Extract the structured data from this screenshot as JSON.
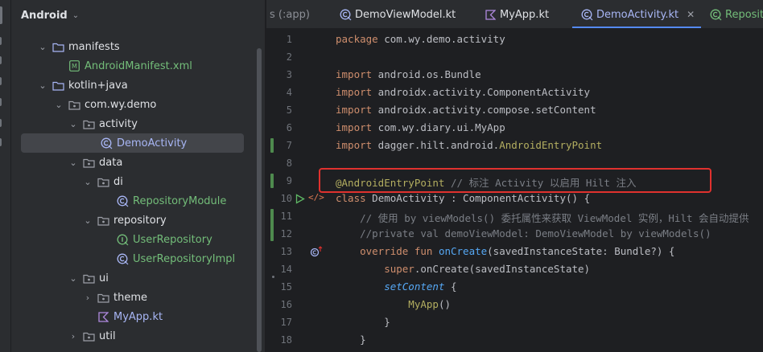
{
  "project_panel": {
    "title": "Android",
    "tree": [
      {
        "label": "manifests",
        "type": "folder"
      },
      {
        "label": "AndroidManifest.xml",
        "type": "manifest-file"
      },
      {
        "label": "kotlin+java",
        "type": "folder"
      },
      {
        "label": "com.wy.demo",
        "type": "package"
      },
      {
        "label": "activity",
        "type": "package"
      },
      {
        "label": "DemoActivity",
        "type": "class",
        "selected": true
      },
      {
        "label": "data",
        "type": "package"
      },
      {
        "label": "di",
        "type": "package"
      },
      {
        "label": "RepositoryModule",
        "type": "class"
      },
      {
        "label": "repository",
        "type": "package"
      },
      {
        "label": "UserRepository",
        "type": "interface"
      },
      {
        "label": "UserRepositoryImpl",
        "type": "class"
      },
      {
        "label": "ui",
        "type": "package"
      },
      {
        "label": "theme",
        "type": "package"
      },
      {
        "label": "MyApp.kt",
        "type": "kotlin-file"
      },
      {
        "label": "util",
        "type": "package"
      }
    ]
  },
  "tabs": [
    {
      "label": "s (:app)",
      "active": false
    },
    {
      "label": "DemoViewModel.kt",
      "active": false
    },
    {
      "label": "MyApp.kt",
      "active": false
    },
    {
      "label": "DemoActivity.kt",
      "active": true
    },
    {
      "label": "Reposit",
      "active": false
    }
  ],
  "editor": {
    "line_numbers": [
      "1",
      "2",
      "3",
      "4",
      "5",
      "6",
      "7",
      "8",
      "9",
      "10",
      "11",
      "12",
      "13",
      "14",
      "15",
      "16",
      "17",
      "18"
    ],
    "lines": {
      "l1_kw": "package",
      "l1_rest": " com.wy.demo.activity",
      "l3_kw": "import",
      "l3_rest": " android.os.Bundle",
      "l4_kw": "import",
      "l4_rest": " androidx.activity.ComponentActivity",
      "l5_kw": "import",
      "l5_rest": " androidx.activity.compose.setContent",
      "l6_kw": "import",
      "l6_rest": " com.wy.diary.ui.MyApp",
      "l7_kw": "import",
      "l7_rest": " dagger.hilt.android.",
      "l7_ann": "AndroidEntryPoint",
      "l9_ann": "@AndroidEntryPoint",
      "l9_cmt": " // 标注 Activity 以启用 Hilt 注入",
      "l10_kw": "class",
      "l10_rest": " DemoActivity : ComponentActivity() {",
      "l11_cmt": "    // 使用 by viewModels() 委托属性来获取 ViewModel 实例，Hilt 会自动提供",
      "l12_cmt": "    //private val demoViewModel: DemoViewModel by viewModels()",
      "l13_kw": "    override fun",
      "l13_fn": " onCreate",
      "l13_rest": "(savedInstanceState: Bundle?) {",
      "l14_kw": "        super",
      "l14_rest": ".onCreate(savedInstanceState)",
      "l15_fn": "        setContent",
      "l15_rest": " {",
      "l16_call": "            MyApp",
      "l16_rest": "()",
      "l17": "        }",
      "l18": "    }"
    }
  },
  "colors": {
    "keyword": "#cf8e6d",
    "annotation": "#b3ae60",
    "comment": "#7a7e85",
    "function": "#56a8f5",
    "highlight_box": "#e0312e",
    "active_tab_underline": "#548af7"
  }
}
